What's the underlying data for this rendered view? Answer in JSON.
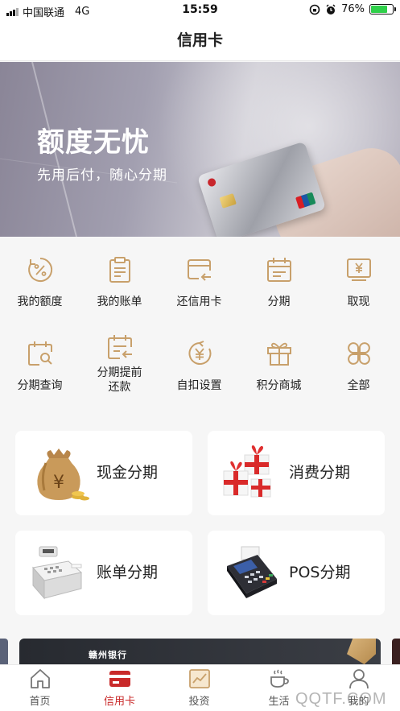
{
  "status_bar": {
    "carrier": "中国联通",
    "network": "4G",
    "time": "15:59",
    "battery_percent": "76%",
    "battery_level": 0.76
  },
  "nav": {
    "title": "信用卡"
  },
  "banner": {
    "title": "额度无忧",
    "subtitle": "先用后付，随心分期"
  },
  "menu": {
    "items": [
      {
        "label": "我的额度",
        "icon": "percent-circle-icon"
      },
      {
        "label": "我的账单",
        "icon": "clipboard-icon"
      },
      {
        "label": "还信用卡",
        "icon": "card-return-icon"
      },
      {
        "label": "分期",
        "icon": "calendar-icon"
      },
      {
        "label": "取现",
        "icon": "atm-yuan-icon"
      },
      {
        "label": "分期查询",
        "icon": "calendar-search-icon"
      },
      {
        "label": "分期提前\n还款",
        "icon": "calendar-return-icon"
      },
      {
        "label": "自扣设置",
        "icon": "yuan-cycle-icon"
      },
      {
        "label": "积分商城",
        "icon": "gift-icon"
      },
      {
        "label": "全部",
        "icon": "grid-all-icon"
      }
    ]
  },
  "tiles": [
    {
      "label": "现金分期",
      "icon": "money-bag-icon"
    },
    {
      "label": "消费分期",
      "icon": "gift-boxes-icon"
    },
    {
      "label": "账单分期",
      "icon": "cash-register-icon"
    },
    {
      "label": "POS分期",
      "icon": "pos-terminal-icon"
    }
  ],
  "ad": {
    "logo_text": "赣州银行"
  },
  "tab_bar": {
    "tabs": [
      {
        "label": "首页",
        "icon": "home-icon",
        "active": false
      },
      {
        "label": "信用卡",
        "icon": "credit-card-icon",
        "active": true
      },
      {
        "label": "投资",
        "icon": "chart-icon",
        "active": false
      },
      {
        "label": "生活",
        "icon": "coffee-icon",
        "active": false
      },
      {
        "label": "我的",
        "icon": "user-icon",
        "active": false
      }
    ]
  },
  "watermark": "QQTF.COM",
  "colors": {
    "accent": "#c9a06a",
    "active_tab": "#c92a2a",
    "icon_gold": "#c8a06b"
  }
}
